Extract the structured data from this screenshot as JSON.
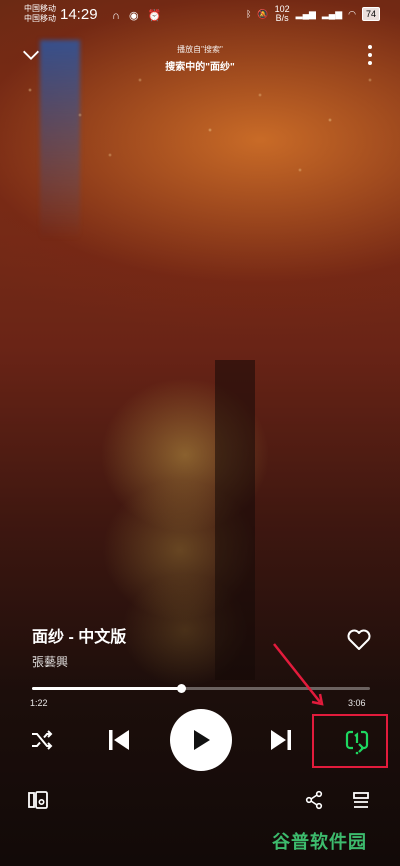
{
  "status_bar": {
    "carrier_1": "中国移动",
    "carrier_2": "中国移动",
    "time": "14:29",
    "speed_value": "102",
    "speed_unit": "B/s",
    "battery": "74"
  },
  "header": {
    "source_label": "播放自\"搜索\"",
    "source_title": "搜索中的\"面纱\""
  },
  "track": {
    "title": "面纱 - 中文版",
    "artist": "張藝興"
  },
  "progress": {
    "elapsed": "1:22",
    "total": "3:06",
    "fraction": 0.44
  },
  "icons": {
    "collapse": "chevron-down-icon",
    "more": "more-vertical-icon",
    "like": "heart-icon",
    "shuffle": "shuffle-icon",
    "previous": "skip-previous-icon",
    "play": "play-icon",
    "next": "skip-next-icon",
    "repeat": "repeat-one-icon",
    "devices": "connect-devices-icon",
    "share": "share-icon",
    "queue": "queue-icon"
  },
  "colors": {
    "repeat_active": "#1ed760",
    "annotation": "#e21b3c",
    "watermark": "#3dbb6d"
  },
  "watermark": {
    "text": "谷普软件园"
  }
}
